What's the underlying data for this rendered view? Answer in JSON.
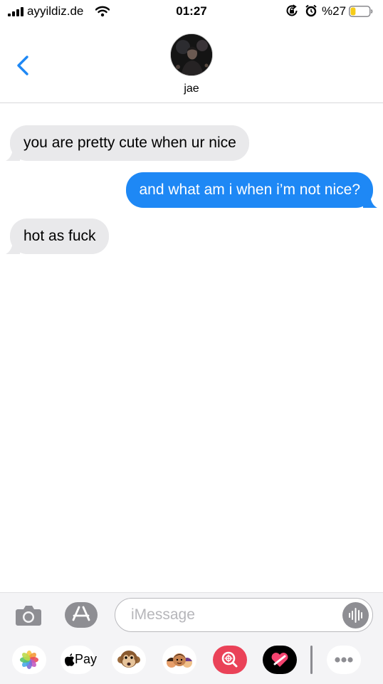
{
  "status": {
    "carrier": "ayyildiz.de",
    "time": "01:27",
    "battery_percent": "%27",
    "battery_level": 0.27,
    "battery_color": "#f5cc1a"
  },
  "header": {
    "contact_name": "jae",
    "back_icon": "chevron-left-icon",
    "accent": "#1e88f5"
  },
  "messages": [
    {
      "direction": "incoming",
      "text": "you are pretty cute when ur nice"
    },
    {
      "direction": "outgoing",
      "text": "and what am i when i’m not nice?"
    },
    {
      "direction": "incoming",
      "text": "hot as fuck"
    }
  ],
  "composer": {
    "placeholder": "iMessage",
    "camera_icon": "camera-icon",
    "appstore_icon": "app-store-icon",
    "audio_icon": "waveform-icon"
  },
  "app_drawer": {
    "apple_pay_label": "Pay",
    "items": [
      "photos-icon",
      "apple-pay-icon",
      "animoji-icon",
      "memoji-icon",
      "image-search-icon",
      "digital-touch-icon",
      "more-icon"
    ]
  }
}
